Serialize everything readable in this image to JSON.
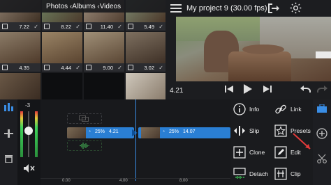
{
  "browser": {
    "nav_title": "Photos ‹Albums ‹Videos",
    "thumbs": [
      {
        "duration": "7.22",
        "checked": true
      },
      {
        "duration": "8.22",
        "checked": true
      },
      {
        "duration": "11.40",
        "checked": true
      },
      {
        "duration": "5.49",
        "checked": true
      },
      {
        "duration": "4.35",
        "checked": false
      },
      {
        "duration": "4.44",
        "checked": true
      },
      {
        "duration": "9.00",
        "checked": true
      },
      {
        "duration": "3.02",
        "checked": true
      }
    ]
  },
  "preview": {
    "project_title": "My project 9  (30.00 fps)",
    "timecode": "4.21"
  },
  "meter": {
    "level_label": "-3"
  },
  "timeline": {
    "clips": [
      {
        "percent": "25%",
        "duration": "4.21"
      },
      {
        "percent": "25%",
        "duration": "14.07"
      }
    ],
    "ruler": [
      "0.00",
      "4.00",
      "8.00"
    ]
  },
  "menu": {
    "info": "Info",
    "link": "Link",
    "slip": "Slip",
    "presets": "Presets",
    "clone": "Clone",
    "edit": "Edit",
    "detach": "Detach",
    "clip": "Clip"
  },
  "colors": {
    "accent": "#2a7fd4",
    "playhead": "#3a8ee6",
    "meter_green": "#3fd35a"
  }
}
